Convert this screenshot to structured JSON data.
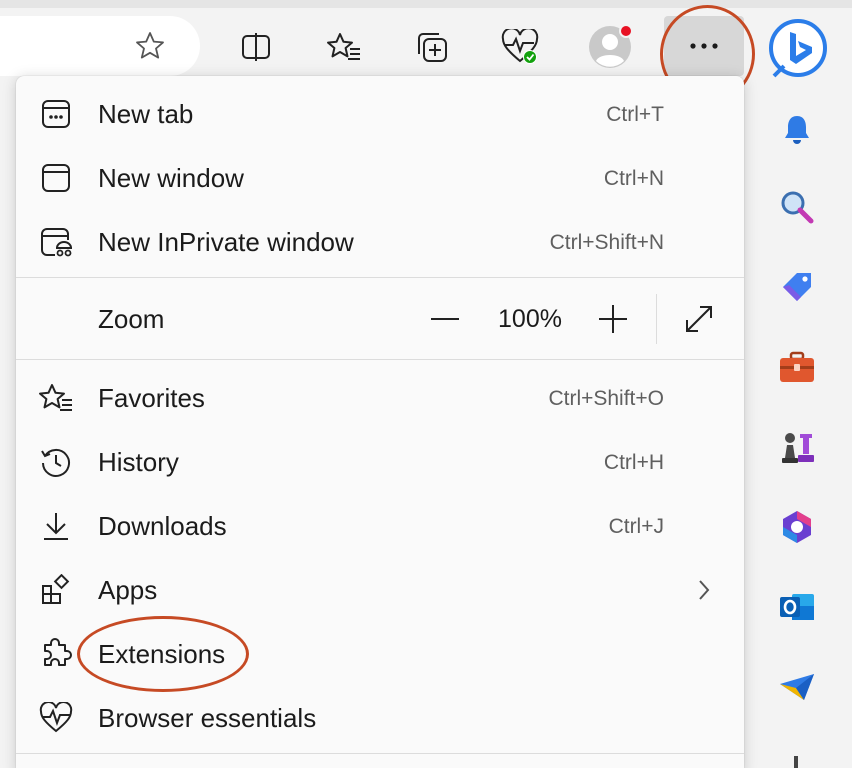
{
  "toolbar": {
    "icons": [
      "favorite-star-icon",
      "split-screen-icon",
      "favorites-icon",
      "collections-icon",
      "browser-essentials-icon",
      "profile-icon",
      "more-icon",
      "bing-copilot-icon"
    ],
    "notification_dot_color": "#e81123"
  },
  "menu": {
    "items_top": [
      {
        "label": "New tab",
        "shortcut": "Ctrl+T",
        "icon": "new-tab-icon"
      },
      {
        "label": "New window",
        "shortcut": "Ctrl+N",
        "icon": "new-window-icon"
      },
      {
        "label": "New InPrivate window",
        "shortcut": "Ctrl+Shift+N",
        "icon": "inprivate-icon"
      }
    ],
    "zoom": {
      "label": "Zoom",
      "value": "100%",
      "minus": "−",
      "plus": "+"
    },
    "items_bottom": [
      {
        "label": "Favorites",
        "shortcut": "Ctrl+Shift+O",
        "icon": "favorites-icon"
      },
      {
        "label": "History",
        "shortcut": "Ctrl+H",
        "icon": "history-icon"
      },
      {
        "label": "Downloads",
        "shortcut": "Ctrl+J",
        "icon": "download-icon"
      },
      {
        "label": "Apps",
        "shortcut": "",
        "icon": "apps-icon"
      },
      {
        "label": "Extensions",
        "shortcut": "",
        "icon": "extensions-icon"
      },
      {
        "label": "Browser essentials",
        "shortcut": "",
        "icon": "browser-essentials-icon"
      }
    ]
  },
  "sidebar": {
    "icons": [
      "bell-icon",
      "search-icon",
      "shopping-tag-icon",
      "tools-icon",
      "games-icon",
      "microsoft-365-icon",
      "outlook-icon",
      "send-icon"
    ]
  },
  "colors": {
    "annotation": "#c64a24",
    "menu_bg": "#fafafa",
    "accent_blue": "#1a73e8"
  }
}
